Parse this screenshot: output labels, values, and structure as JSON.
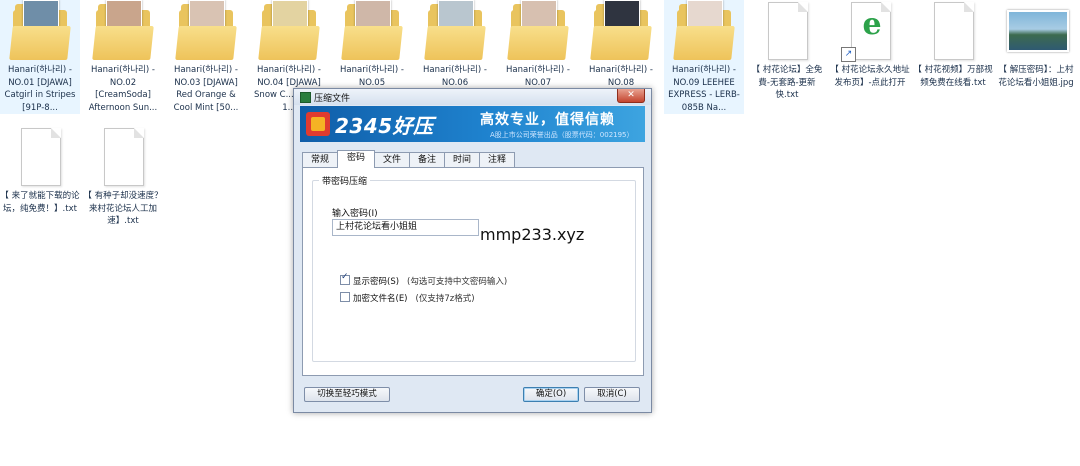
{
  "desktop": {
    "files": [
      {
        "label": "Hanari(하나리) - NO.01 [DJAWA] Catgirl in Stripes [91P-8...",
        "type": "folder",
        "photo": "#6f8ea8"
      },
      {
        "label": "Hanari(하나리) - NO.02 [CreamSoda] Afternoon Sun...",
        "type": "folder",
        "photo": "#c9a58c"
      },
      {
        "label": "Hanari(하나리) - NO.03 [DJAWA] Red Orange & Cool Mint [50...",
        "type": "folder",
        "photo": "#d9c3b3"
      },
      {
        "label": "Hanari(하나리) - NO.04 [DJAWA] Snow C... [119P-1...",
        "type": "folder",
        "photo": "#e3d3a1"
      },
      {
        "label": "Hanari(하나리) - NO.05",
        "type": "folder",
        "photo": "#cfb7a8"
      },
      {
        "label": "Hanari(하나리) - NO.06",
        "type": "folder",
        "photo": "#b9c6cf"
      },
      {
        "label": "Hanari(하나리) - NO.07",
        "type": "folder",
        "photo": "#d7c0b0"
      },
      {
        "label": "Hanari(하나리) - NO.08",
        "type": "folder",
        "photo": "#2f3440"
      },
      {
        "label": "Hanari(하나리) - NO.09 LEEHEE EXPRESS - LERB-085B Na...",
        "type": "folder",
        "photo": "#e6d8cf"
      },
      {
        "label": "【 村花论坛】全免費-无套路-更新快.txt",
        "type": "txt"
      },
      {
        "label": "【 村花论坛永久地址发布页】-点此打开",
        "type": "shortcut"
      },
      {
        "label": "【 村花视频】万部视频免费在线看.txt",
        "type": "txt"
      },
      {
        "label": "【 解压密码】：上村花论坛看小姐姐.jpg",
        "type": "image"
      },
      {
        "label": "【 来了就能下载的论坛，纯免费！】.txt",
        "type": "txt"
      },
      {
        "label": "【 有种子却没速度？来村花论坛人工加速】.txt",
        "type": "txt"
      }
    ]
  },
  "dialog": {
    "title": "压缩文件",
    "close_label": "✕",
    "brand": "2345好压",
    "slogan": "高效专业，值得信赖",
    "subslogan": "A股上市公司荣誉出品（股票代码：002195）",
    "tabs": [
      {
        "label": "常规",
        "active": false
      },
      {
        "label": "密码",
        "active": true
      },
      {
        "label": "文件",
        "active": false
      },
      {
        "label": "备注",
        "active": false
      },
      {
        "label": "时间",
        "active": false
      },
      {
        "label": "注释",
        "active": false
      }
    ],
    "group_title": "带密码压缩",
    "password_label": "输入密码(I)",
    "password_value": "上村花论坛看小姐姐",
    "show_password": {
      "label": "显示密码(S)",
      "hint": "(勾选可支持中文密码输入)",
      "checked": true
    },
    "encrypt_names": {
      "label": "加密文件名(E)",
      "hint": "(仅支持7z格式)",
      "checked": false
    },
    "switch_mode_label": "切换至轻巧模式",
    "ok_label": "确定(O)",
    "cancel_label": "取消(C)"
  },
  "watermark": "mmp233.xyz",
  "colors": {
    "accent": "#1f83cf",
    "folder": "#e9c45e",
    "close": "#c4452f"
  }
}
